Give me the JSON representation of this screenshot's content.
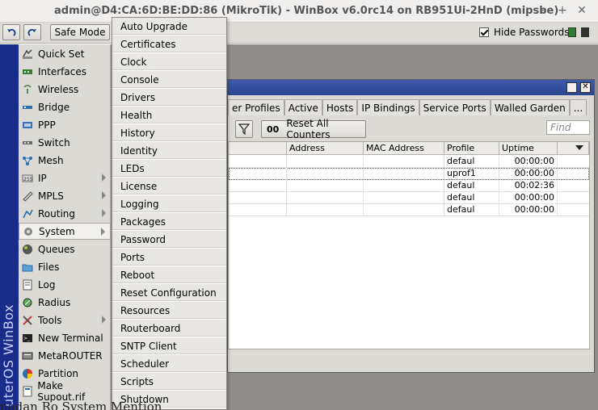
{
  "window": {
    "title": "admin@D4:CA:6D:BE:DD:86 (MikroTik) - WinBox v6.0rc14 on RB951Ui-2HnD (mipsbe)",
    "controls": [
      "–",
      "+",
      "✕"
    ]
  },
  "toolbar": {
    "undo_icon": "undo-icon",
    "redo_icon": "redo-icon",
    "safe_mode_label": "Safe Mode",
    "hide_passwords_label": "Hide Passwords",
    "hide_passwords_checked": true,
    "lock_colors": [
      "#2e7d32",
      "#333333"
    ]
  },
  "side_strip": {
    "text": "uterOS WinBox"
  },
  "main_menu": {
    "items": [
      {
        "label": "Quick Set",
        "icon": "quick-set-icon"
      },
      {
        "label": "Interfaces",
        "icon": "interfaces-icon"
      },
      {
        "label": "Wireless",
        "icon": "wireless-icon"
      },
      {
        "label": "Bridge",
        "icon": "bridge-icon"
      },
      {
        "label": "PPP",
        "icon": "ppp-icon"
      },
      {
        "label": "Switch",
        "icon": "switch-icon"
      },
      {
        "label": "Mesh",
        "icon": "mesh-icon"
      },
      {
        "label": "IP",
        "icon": "ip-icon",
        "submenu": true
      },
      {
        "label": "MPLS",
        "icon": "mpls-icon",
        "submenu": true
      },
      {
        "label": "Routing",
        "icon": "routing-icon",
        "submenu": true
      },
      {
        "label": "System",
        "icon": "system-icon",
        "submenu": true,
        "active": true
      },
      {
        "label": "Queues",
        "icon": "queues-icon"
      },
      {
        "label": "Files",
        "icon": "files-icon"
      },
      {
        "label": "Log",
        "icon": "log-icon"
      },
      {
        "label": "Radius",
        "icon": "radius-icon"
      },
      {
        "label": "Tools",
        "icon": "tools-icon",
        "submenu": true
      },
      {
        "label": "New Terminal",
        "icon": "terminal-icon"
      },
      {
        "label": "MetaROUTER",
        "icon": "metarouter-icon"
      },
      {
        "label": "Partition",
        "icon": "partition-icon"
      },
      {
        "label": "Make Supout.rif",
        "icon": "supout-icon"
      }
    ]
  },
  "system_submenu": {
    "items": [
      "Auto Upgrade",
      "Certificates",
      "Clock",
      "Console",
      "Drivers",
      "Health",
      "History",
      "Identity",
      "LEDs",
      "License",
      "Logging",
      "Packages",
      "Password",
      "Ports",
      "Reboot",
      "Reset Configuration",
      "Resources",
      "Routerboard",
      "SNTP Client",
      "Scheduler",
      "Scripts",
      "Shutdown"
    ]
  },
  "ppp_window": {
    "tabs": [
      "er Profiles",
      "Active",
      "Hosts",
      "IP Bindings",
      "Service Ports",
      "Walled Garden",
      "..."
    ],
    "reset_counters_label": "Reset All Counters",
    "reset_counters_prefix": "00",
    "find_placeholder": "Find",
    "columns": [
      "",
      "Address",
      "MAC Address",
      "Profile",
      "Uptime"
    ],
    "rows": [
      {
        "address": "",
        "mac": "",
        "profile": "defaul",
        "uptime": "00:00:00",
        "selected": false
      },
      {
        "address": "",
        "mac": "",
        "profile": "uprof1",
        "uptime": "00:00:00",
        "selected": true
      },
      {
        "address": "",
        "mac": "",
        "profile": "defaul",
        "uptime": "00:02:36",
        "selected": false
      },
      {
        "address": "",
        "mac": "",
        "profile": "defaul",
        "uptime": "00:00:00",
        "selected": false
      },
      {
        "address": "",
        "mac": "",
        "profile": "defaul",
        "uptime": "00:00:00",
        "selected": false
      }
    ]
  },
  "stray_text": "nadan Ro System Mention"
}
